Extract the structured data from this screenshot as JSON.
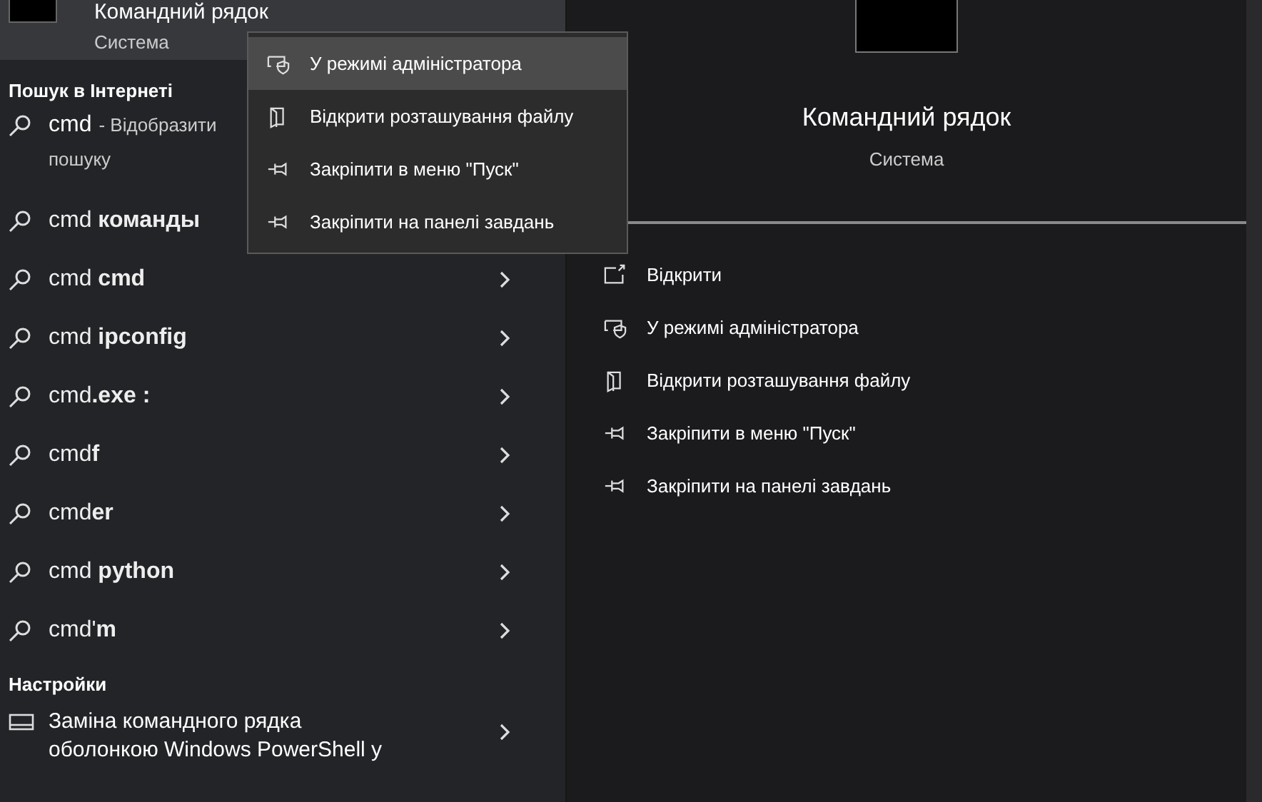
{
  "best_match": {
    "title": "Командний рядок",
    "subtitle": "Система",
    "selected": true
  },
  "web_section": {
    "heading": "Пошук в Інтернеті",
    "first": {
      "query": "cmd",
      "hint": "- Відобразити",
      "line2": "пошуку"
    },
    "items": [
      {
        "text": "cmd **команды**"
      },
      {
        "text": "cmd **cmd**",
        "arrow": true
      },
      {
        "text": "cmd **ipconfig**",
        "arrow": true
      },
      {
        "text": "cmd**.exe :**",
        "arrow": true
      },
      {
        "text": "cmd**f**",
        "arrow": true
      },
      {
        "text": "cmd**er**",
        "arrow": true
      },
      {
        "text": "cmd **python**",
        "arrow": true
      },
      {
        "text": "cmd'**m**",
        "arrow": true
      }
    ]
  },
  "settings_section": {
    "heading": "Настройки",
    "items": [
      {
        "line1": "Заміна командного рядка",
        "line2": "оболонкою Windows PowerShell у"
      }
    ]
  },
  "context_menu": [
    {
      "label": "У режимі адміністратора",
      "selected": true
    },
    {
      "label": "Відкрити розташування файлу",
      "selected": false
    },
    {
      "label": "Закріпити в меню \"Пуск\"",
      "selected": false
    },
    {
      "label": "Закріпити на панелі завдань",
      "selected": false
    }
  ],
  "details": {
    "title": "Командний рядок",
    "subtitle": "Система",
    "actions": [
      {
        "label": "Відкрити"
      },
      {
        "label": "У режимі адміністратора"
      },
      {
        "label": "Відкрити розташування файлу"
      },
      {
        "label": "Закріпити в меню \"Пуск\""
      },
      {
        "label": "Закріпити на панелі завдань"
      }
    ]
  }
}
